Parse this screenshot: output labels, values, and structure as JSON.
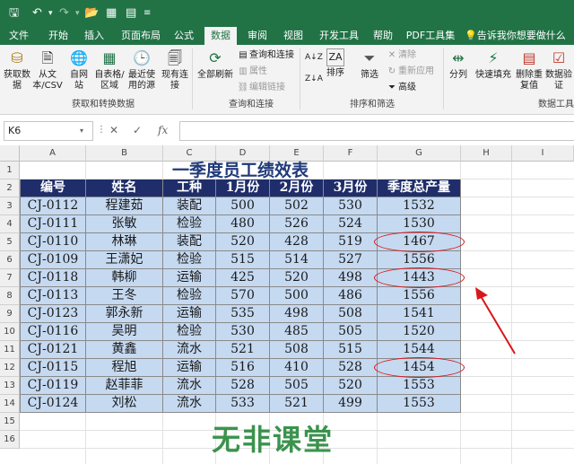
{
  "titlebar": {
    "icons": [
      "save-icon",
      "undo-icon",
      "redo-icon",
      "open-folder-icon",
      "form-icon",
      "layout-icon",
      "customize-icon"
    ]
  },
  "tabs": [
    "文件",
    "开始",
    "插入",
    "页面布局",
    "公式",
    "数据",
    "审阅",
    "视图",
    "开发工具",
    "帮助",
    "PDF工具集"
  ],
  "active_tab": "数据",
  "tell_me": "告诉我你想要做什么",
  "ribbon": {
    "get_data": {
      "buttons": [
        "获取数据",
        "从文本/CSV",
        "自网站",
        "自表格/区域",
        "最近使用的源",
        "现有连接"
      ],
      "label": "获取和转换数据"
    },
    "queries": {
      "refresh": "全部刷新",
      "small": [
        "查询和连接",
        "属性",
        "编辑链接"
      ],
      "label": "查询和连接"
    },
    "sort_filter": {
      "sort_asc": "A↓Z",
      "sort_desc": "Z↓A",
      "sort": "排序",
      "filter": "筛选",
      "small": [
        "清除",
        "重新应用",
        "高级"
      ],
      "label": "排序和筛选"
    },
    "data_tools": {
      "buttons": [
        "分列",
        "快速填充",
        "删除重复值",
        "数据验证"
      ],
      "label": "数据工具"
    }
  },
  "formula_bar": {
    "name_box": "K6",
    "cancel": "✕",
    "enter": "✓",
    "fx": "fx",
    "value": ""
  },
  "columns": [
    "A",
    "B",
    "C",
    "D",
    "E",
    "F",
    "G",
    "H",
    "I"
  ],
  "rows": [
    "1",
    "2",
    "3",
    "4",
    "5",
    "6",
    "7",
    "8",
    "9",
    "10",
    "11",
    "12",
    "13",
    "14",
    "15",
    "16"
  ],
  "sheet": {
    "title": "一季度员工绩效表",
    "headers": [
      "编号",
      "姓名",
      "工种",
      "1月份",
      "2月份",
      "3月份",
      "季度总产量"
    ],
    "records": [
      [
        "CJ-0112",
        "程建茹",
        "装配",
        "500",
        "502",
        "530",
        "1532"
      ],
      [
        "CJ-0111",
        "张敏",
        "检验",
        "480",
        "526",
        "524",
        "1530"
      ],
      [
        "CJ-0110",
        "林琳",
        "装配",
        "520",
        "428",
        "519",
        "1467"
      ],
      [
        "CJ-0109",
        "王潇妃",
        "检验",
        "515",
        "514",
        "527",
        "1556"
      ],
      [
        "CJ-0118",
        "韩柳",
        "运输",
        "425",
        "520",
        "498",
        "1443"
      ],
      [
        "CJ-0113",
        "王冬",
        "检验",
        "570",
        "500",
        "486",
        "1556"
      ],
      [
        "CJ-0123",
        "郭永新",
        "运输",
        "535",
        "498",
        "508",
        "1541"
      ],
      [
        "CJ-0116",
        "吴明",
        "检验",
        "530",
        "485",
        "505",
        "1520"
      ],
      [
        "CJ-0121",
        "黄鑫",
        "流水",
        "521",
        "508",
        "515",
        "1544"
      ],
      [
        "CJ-0115",
        "程旭",
        "运输",
        "516",
        "410",
        "528",
        "1454"
      ],
      [
        "CJ-0119",
        "赵菲菲",
        "流水",
        "528",
        "505",
        "520",
        "1553"
      ],
      [
        "CJ-0124",
        "刘松",
        "流水",
        "533",
        "521",
        "499",
        "1553"
      ]
    ],
    "highlighted_totals": [
      "1467",
      "1443",
      "1454"
    ]
  },
  "annotation_color": "#d8171b",
  "watermark": "无非课堂"
}
